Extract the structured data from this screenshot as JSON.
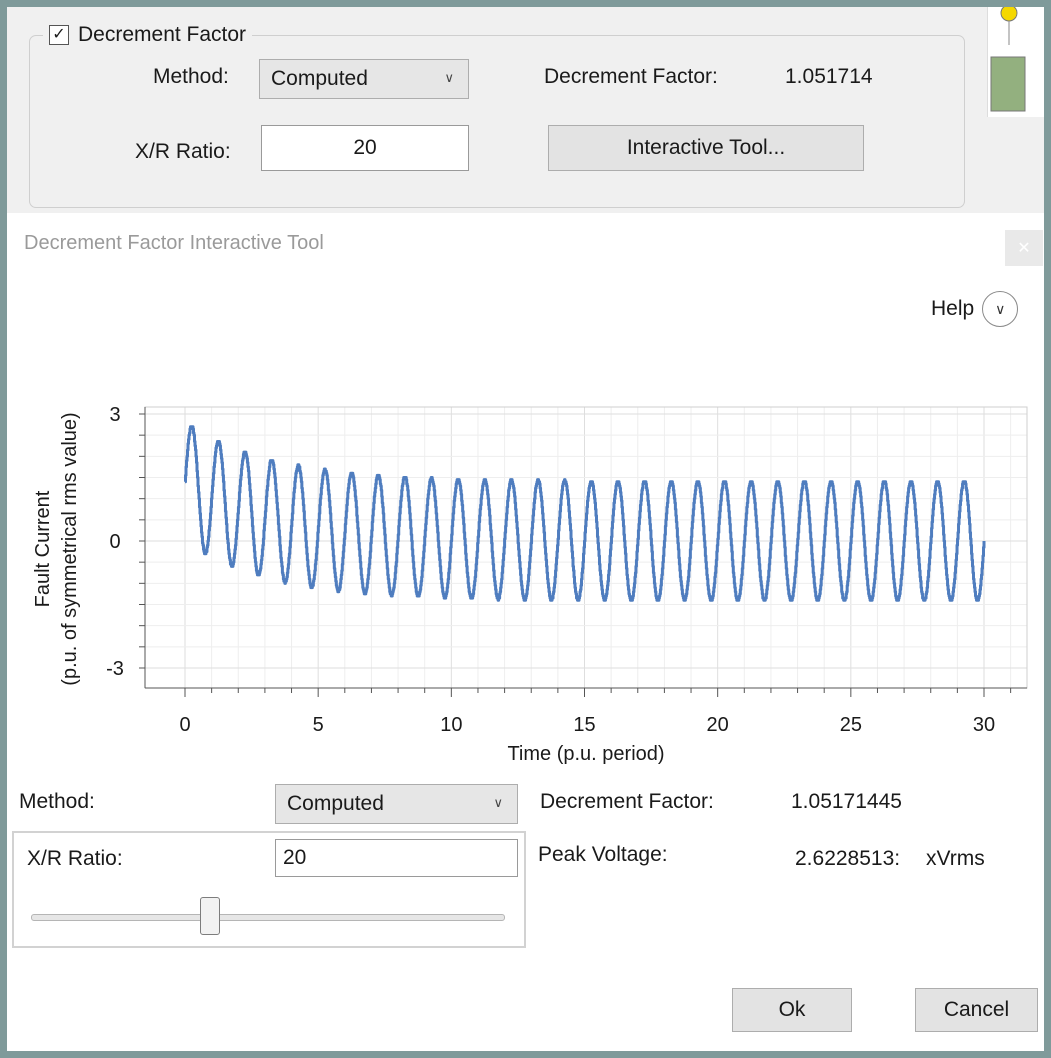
{
  "top_panel": {
    "group_title": "Decrement Factor",
    "group_checked": "✓",
    "method_label": "Method:",
    "method_value": "Computed",
    "decrement_label": "Decrement Factor:",
    "decrement_value": "1.051714",
    "xr_label": "X/R Ratio:",
    "xr_value": "20",
    "interactive_button": "Interactive Tool..."
  },
  "dialog": {
    "title": "Decrement Factor Interactive Tool",
    "close_icon": "close-icon",
    "help_label": "Help",
    "method_label": "Method:",
    "method_value": "Computed",
    "decrement_label": "Decrement Factor:",
    "decrement_value": "1.05171445",
    "peak_label": "Peak Voltage:",
    "peak_value": "2.6228513:",
    "peak_unit": "xVrms",
    "xr_label": "X/R Ratio:",
    "xr_value": "20",
    "slider_fraction": 0.38,
    "ok_label": "Ok",
    "cancel_label": "Cancel"
  },
  "chart_data": {
    "type": "line",
    "title": "",
    "xlabel": "Time (p.u. period)",
    "ylabel_line1": "Fault Current",
    "ylabel_line2": "(p.u. of symmetrical rms value)",
    "xlim": [
      0,
      30
    ],
    "ylim": [
      -3,
      3
    ],
    "xticks": [
      "0",
      "5",
      "10",
      "15",
      "20",
      "25",
      "30"
    ],
    "yticks": [
      "3",
      "0",
      "-3"
    ],
    "grid": true,
    "line_color": "#4f7dbf",
    "series": [
      {
        "x_start": 0,
        "x_end": 30,
        "peak_amplitude": 1.4142,
        "decay_tau_periods": 3.18,
        "peak_value": 2.6228513
      }
    ]
  }
}
